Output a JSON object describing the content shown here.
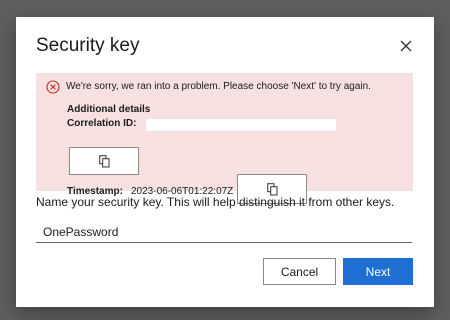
{
  "dialog": {
    "title": "Security key",
    "close_icon": "close-icon"
  },
  "error": {
    "icon": "error-circle-icon",
    "message": "We're sorry, we ran into a problem. Please choose 'Next' to try again.",
    "details_heading": "Additional details",
    "correlation_label": "Correlation ID:",
    "correlation_value": "",
    "timestamp_label": "Timestamp:",
    "timestamp_value": "2023-06-06T01:22:07Z",
    "copy_icon": "copy-icon"
  },
  "form": {
    "instruction": "Name your security key. This will help distinguish it from other keys.",
    "name_value": "OnePassword"
  },
  "buttons": {
    "cancel_label": "Cancel",
    "next_label": "Next"
  },
  "colors": {
    "error_background": "#f7e1e0",
    "error_icon": "#c42b1c",
    "primary": "#1f6ed4"
  }
}
